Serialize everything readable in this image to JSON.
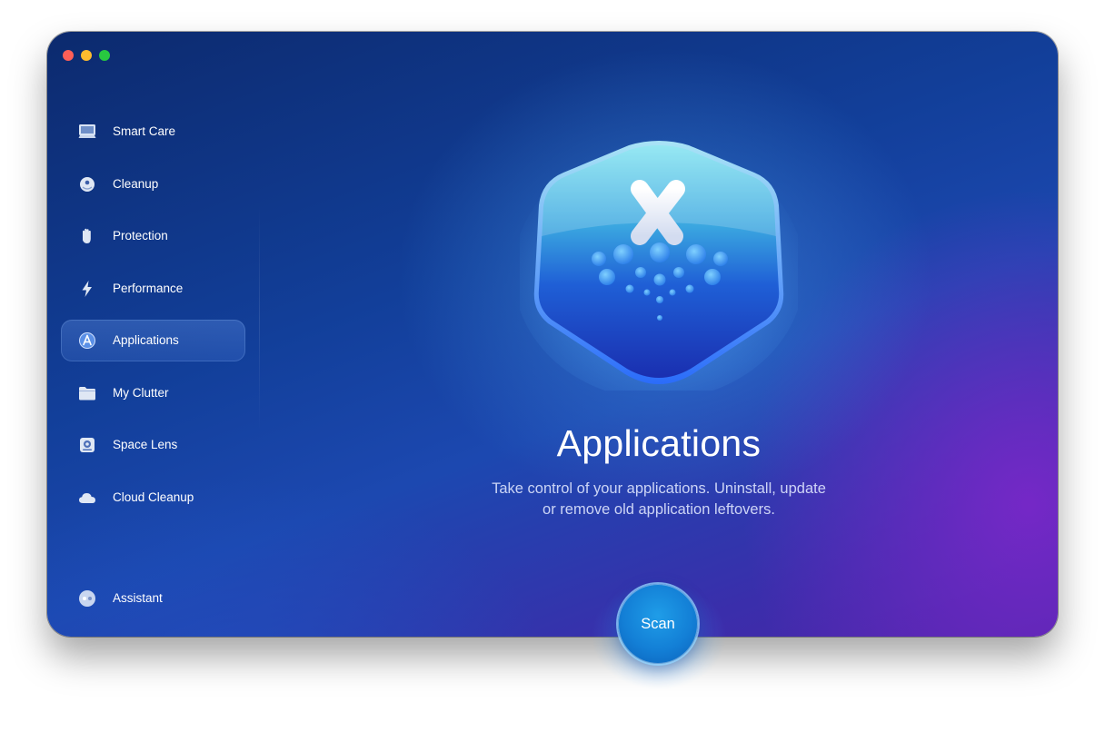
{
  "window": {
    "controls": [
      "close",
      "minimize",
      "zoom"
    ]
  },
  "sidebar": {
    "items": [
      {
        "label": "Smart Care",
        "icon": "smart-care-icon"
      },
      {
        "label": "Cleanup",
        "icon": "cleanup-icon"
      },
      {
        "label": "Protection",
        "icon": "hand-icon"
      },
      {
        "label": "Performance",
        "icon": "lightning-icon"
      },
      {
        "label": "Applications",
        "icon": "applications-icon",
        "active": true
      },
      {
        "label": "My Clutter",
        "icon": "folder-icon"
      },
      {
        "label": "Space Lens",
        "icon": "space-lens-icon"
      },
      {
        "label": "Cloud Cleanup",
        "icon": "cloud-icon"
      }
    ],
    "assistant": {
      "label": "Assistant",
      "icon": "assistant-icon"
    }
  },
  "main": {
    "title": "Applications",
    "description_line1": "Take control of your applications. Uninstall, update",
    "description_line2": "or remove old application leftovers.",
    "hero_icon": "applications-hero-icon",
    "scan_label": "Scan"
  },
  "colors": {
    "accent": "#137fd6",
    "close": "#ff5f57",
    "minimize": "#febc2e",
    "zoom": "#28c840"
  }
}
